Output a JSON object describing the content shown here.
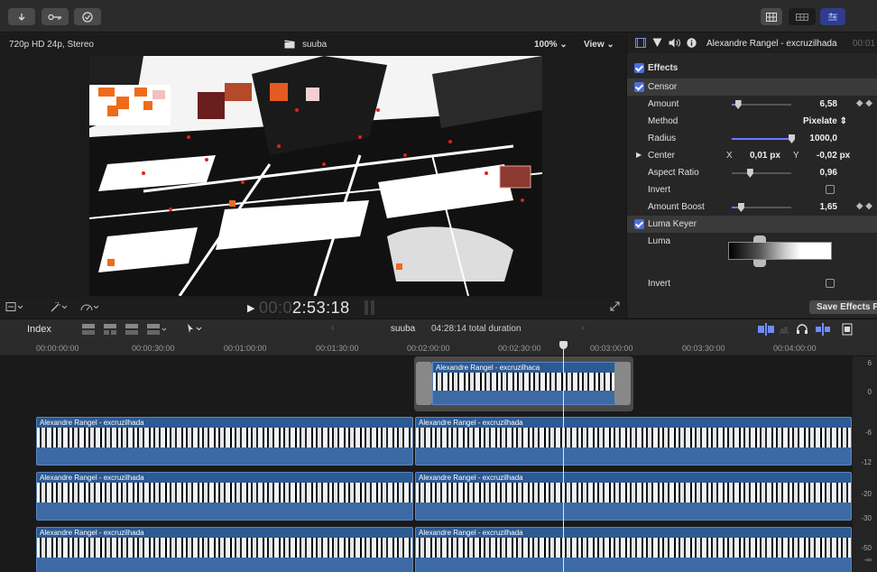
{
  "toolbar": {
    "buttons": [
      "import-icon",
      "keywords-icon",
      "background-tasks-icon"
    ],
    "view_buttons": [
      "browser-icon",
      "timeline-icon",
      "inspector-icon"
    ]
  },
  "viewer": {
    "format": "720p HD 24p, Stereo",
    "title": "suuba",
    "zoom": "100%",
    "view": "View",
    "timecode_dim": "00:0",
    "timecode_main": "2:53:18"
  },
  "inspector": {
    "clip_name": "Alexandre Rangel - excruzilhada",
    "timecode_partial": "00:01",
    "effects_label": "Effects",
    "censor": {
      "label": "Censor",
      "amount_label": "Amount",
      "amount": "6,58",
      "amount_frac": 0.1,
      "method_label": "Method",
      "method": "Pixelate",
      "radius_label": "Radius",
      "radius": "1000,0",
      "radius_frac": 1.0,
      "center_label": "Center",
      "center_x_label": "X",
      "center_x": "0,01 px",
      "center_y_label": "Y",
      "center_y": "-0,02 px",
      "aspect_label": "Aspect Ratio",
      "aspect": "0,96",
      "aspect_frac": 0.3,
      "invert_label": "Invert",
      "boost_label": "Amount Boost",
      "boost": "1,65",
      "boost_frac": 0.15
    },
    "luma_keyer": {
      "label": "Luma Keyer",
      "luma_label": "Luma",
      "invert_label": "Invert"
    },
    "save_button": "Save Effects Pre"
  },
  "timeline": {
    "index_label": "Index",
    "project": "suuba",
    "duration": "04:28:14 total duration",
    "ruler": [
      "00:00:00:00",
      "00:00:30:00",
      "00:01:00:00",
      "00:01:30:00",
      "00:02:00:00",
      "00:02:30:00",
      "00:03:00:00",
      "00:03:30:00",
      "00:04:00:00"
    ],
    "connected_clip": "Alexandre Rangel - excruzilhaca",
    "clip_name": "Alexandre Rangel - excruzilhada",
    "meter": [
      "6",
      "0",
      "-6",
      "-12",
      "-20",
      "-30",
      "-50",
      "-∞"
    ]
  },
  "colors": {
    "accent": "#4b6de0",
    "clip_blue": "#2c5a93",
    "selection": "#2f3d8c"
  }
}
